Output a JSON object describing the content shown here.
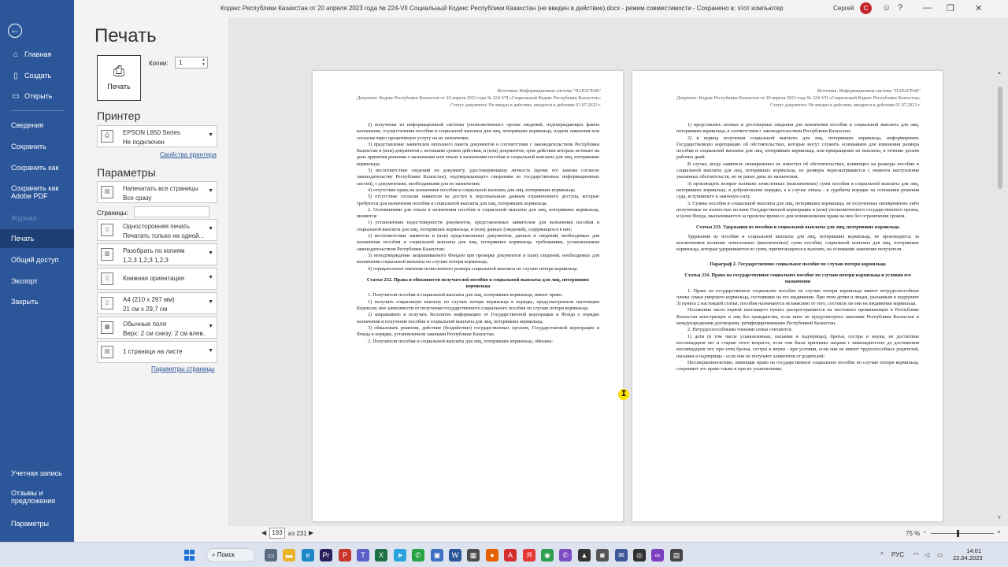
{
  "window": {
    "title": "Кодекс Республики Казахстан от 20 апреля 2023 года № 224-VII Социальный Кодекс Республики Казахстан (не введен в действие).docx  -  режим совместимости  -  Сохранено в: этот компьютер",
    "user": "Сергей",
    "avatar_initial": "С"
  },
  "nav": {
    "items": [
      {
        "label": "Главная",
        "icon": "home-icon"
      },
      {
        "label": "Создать",
        "icon": "new-document-icon"
      },
      {
        "label": "Открыть",
        "icon": "folder-icon"
      },
      {
        "label": "Сведения"
      },
      {
        "label": "Сохранить"
      },
      {
        "label": "Сохранить как"
      },
      {
        "label": "Сохранить как Adobe PDF"
      },
      {
        "label": "Журнал"
      },
      {
        "label": "Печать"
      },
      {
        "label": "Общий доступ"
      },
      {
        "label": "Экспорт"
      },
      {
        "label": "Закрыть"
      },
      {
        "label": "Учетная запись"
      },
      {
        "label": "Отзывы и предложения"
      },
      {
        "label": "Параметры"
      }
    ],
    "active": "Печать",
    "disabled": "Журнал"
  },
  "print": {
    "heading": "Печать",
    "button_label": "Печать",
    "copies_label": "Копии:",
    "copies_value": "1",
    "printer_heading": "Принтер",
    "printer_name": "EPSON L850 Series",
    "printer_status": "Не подключен",
    "printer_props_link": "Свойства принтера",
    "params_heading": "Параметры",
    "settings": [
      {
        "l1": "Напечатать все страницы",
        "l2": "Все сразу"
      },
      {
        "l1": "Односторонняя печать",
        "l2": "Печатать только на одной..."
      },
      {
        "l1": "Разобрать по копиям",
        "l2": "1,2,3    1,2,3    1,2,3"
      },
      {
        "l1": "Книжная ориентация",
        "l2": ""
      },
      {
        "l1": "A4 (210 x 297 мм)",
        "l2": "21 см x 29,7 см"
      },
      {
        "l1": "Обычные поля",
        "l2": "Верх: 2 см снизу: 2 см влев..."
      },
      {
        "l1": "1 страница на листе",
        "l2": ""
      }
    ],
    "pages_label": "Страницы:",
    "pages_value": "",
    "page_setup_link": "Параметры страницы"
  },
  "doc_header": {
    "source": "Источник: Информационная система \"ПАРАГРАФ\"",
    "document": "Документ: Кодекс Республики Казахстан от 20 апреля 2023 года № 224-VII «Социальный Кодекс Республики Казахстан»",
    "status": "Статус документа: Не введен в действие, вводится в действие 01.07.2023 г."
  },
  "page1": {
    "blocks": [
      {
        "t": "p",
        "text": "2) получение из информационной системы уполномоченного органа сведений, подтверждающих факты назначения, осуществления пособия и социальной выплаты для лиц, потерявших кормильца, подачи заявления или согласия через проактивную услугу на их назначение;"
      },
      {
        "t": "p",
        "text": "3) представление заявителем неполного пакета документов в соответствии с законодательством Республики Казахстан и (или) документов с истекшим сроком действия, и (или) документов, срок действия которых истекает на день принятия решения о назначении или отказе в назначении пособия и социальной выплаты для лиц, потерявших кормильца;"
      },
      {
        "t": "p",
        "text": "3) несоответствие сведений по документу, удостоверяющему личность (кроме его замены согласно законодательству Республики Казахстан), подтверждающего сведениям из государственных информационных систем), с документами, необходимыми для их назначения;"
      },
      {
        "t": "p",
        "text": "4) отсутствие права на назначение пособия и социальной выплаты для лиц, потерявших кормильца;"
      },
      {
        "t": "p",
        "text": "5) отсутствие согласия заявителя на доступ к персональным данным ограниченного доступа, которые требуются для назначения пособия и социальной выплаты для лиц, потерявших кормильца."
      },
      {
        "t": "p",
        "text": "2. Основаниями для отказа в назначении пособия и социальной выплаты для лиц, потерявших кормильца, являются:"
      },
      {
        "t": "p",
        "text": "1) установление недостоверности документов, представленных заявителем для назначения пособия и социальной выплаты для лиц, потерявших кормильца, и (или) данных (сведений), содержащихся в них;"
      },
      {
        "t": "p",
        "text": "2) несоответствие заявителя и (или) представленных документов, данных и сведений, необходимых для назначения пособия и социальной выплаты для лиц, потерявших кормильца, требованиям, установленным законодательством Республики Казахстан;"
      },
      {
        "t": "p",
        "text": "3) неподтверждение запрашиваемого Фондом при проверке документов и (или) сведений, необходимых для назначения социальной выплаты по случаю потери кормильца;"
      },
      {
        "t": "p",
        "text": "4) отрицательное значение исчисленного размера социальной выплаты по случаю потери кормильца."
      },
      {
        "t": "art",
        "text": "Статья 232. Права и обязанности получателей пособия и социальной выплаты для лиц, потерявших кормильца"
      },
      {
        "t": "p",
        "text": "1. Получатели пособия и социальной выплаты для лиц, потерявших кормильца, имеют право:"
      },
      {
        "t": "p",
        "text": "1) получить социальную выплату по случаю потери кормильца в порядке, предусмотренном настоящим Кодексом, вне зависимости от получения государственного социального пособия по случаю потери кормильца;"
      },
      {
        "t": "p",
        "text": "2) запрашивать и получать бесплатно информацию от Государственной корпорации и Фонда о порядке назначения и получения пособия и социальной выплаты для лиц, потерявших кормильца;"
      },
      {
        "t": "p",
        "text": "3) обжаловать решения, действия (бездействие) государственных органов, Государственной корпорации и Фонда в порядке, установленном законами Республики Казахстан."
      },
      {
        "t": "p",
        "text": "2. Получатели пособия и социальной выплаты для лиц, потерявших кормильца, обязаны:"
      }
    ]
  },
  "page2": {
    "blocks": [
      {
        "t": "p",
        "text": "1) представлять полные и достоверные сведения для назначения пособия и социальной выплаты для лиц, потерявших кормильца, в соответствии с законодательством Республики Казахстан;"
      },
      {
        "t": "p",
        "text": "2) в период получения социальной выплаты для лиц, потерявших кормильца, информировать Государственную корпорацию об обстоятельствах, которые могут служить основанием для изменения размера пособия и социальной выплаты для лиц, потерявших кормильца, или прекращения их выплаты, в течение десяти рабочих дней."
      },
      {
        "t": "p",
        "text": "В случае, когда заявитель своевременно не известил об обстоятельствах, влияющих на размеры пособия и социальной выплаты для лиц, потерявших кормильца, их размеры пересматриваются с момента наступления указанных обстоятельств, но не ранее даты их назначения;"
      },
      {
        "t": "p",
        "text": "3) производить возврат излишне зачисленных (выплаченных) сумм пособия и социальной выплаты для лиц, потерявших кормильца, в добровольном порядке, а в случае отказа - в судебном порядке на основании решения суда, вступившего в законную силу."
      },
      {
        "t": "p",
        "text": "3. Суммы пособия и социальной выплаты для лиц, потерявших кормильца, не полученные своевременно либо полученные не полностью по вине Государственной корпорации и (или) уполномоченного государственного органа, и (или) Фонда, выплачиваются за прошлое время со дня возникновения права на них без ограничения сроком."
      },
      {
        "t": "art",
        "text": "Статья 233. Удержания из пособия и социальной выплаты для лиц, потерявших кормильца"
      },
      {
        "t": "p",
        "text": "Удержания из пособия и социальной выплаты для лиц, потерявших кормильца, не производятся, за исключением излишне зачисленных (выплаченных) сумм пособия, социальной выплаты для лиц, потерявших кормильца, которые удерживаются из сумм, причитающихся к выплате, на основании заявления получателя."
      },
      {
        "t": "par",
        "text": "Параграф 2. Государственное социальное пособие по случаю потери кормильца"
      },
      {
        "t": "art",
        "text": "Статья 234. Право на государственное социальное пособие по случаю потери кормильца и условия его назначения"
      },
      {
        "t": "p",
        "text": "1. Право на государственное социальное пособие по случаю потери кормильца имеют нетрудоспособные члены семьи умершего кормильца, состоявшие на его иждивении. При этом детям и лицам, указанным в подпункте 3) пункта 2 настоящей статьи, пособия назначаются независимо от того, состояли ли они на иждивении кормильца."
      },
      {
        "t": "p",
        "text": "Положения части первой настоящего пункта распространяются на постоянно проживающих в Республике Казахстан иностранцев и лиц без гражданства, если иное не предусмотрено законами Республики Казахстан и международными договорами, ратифицированными Республикой Казахстан."
      },
      {
        "t": "p",
        "text": "2. Нетрудоспособными членами семьи считаются:"
      },
      {
        "t": "p",
        "text": "1) дети (в том числе усыновленные, пасынки и падчерицы), братья, сестры и внуки, не достигшие восемнадцати лет и старше этого возраста, если они были признаны лицами с инвалидностью до достижения восемнадцати лет, при этом братья, сестры и внуки - при условии, если они не имеют трудоспособных родителей, пасынки и падчерицы - если они не получают алиментов от родителей;"
      },
      {
        "t": "p",
        "text": "Несовершеннолетние, имеющие право на государственное социальное пособие по случаю потери кормильца, сохраняют это право также и при их усыновлении;"
      }
    ]
  },
  "cursor_glyph": "I",
  "preview": {
    "prev_arrow": "◀",
    "next_arrow": "▶",
    "current_page": "193",
    "total_pages": "из 231",
    "zoom": "75 %"
  },
  "taskbar": {
    "search_label": "Поиск",
    "apps": [
      {
        "icon": "task-view-icon",
        "glyph": "▭",
        "color": "#5b6b80"
      },
      {
        "icon": "file-explorer-icon",
        "glyph": "▬",
        "color": "#e8b32b"
      },
      {
        "icon": "edge-icon",
        "glyph": "e",
        "color": "#1e88c7"
      },
      {
        "icon": "premiere-icon",
        "glyph": "Pr",
        "color": "#2a1e5c"
      },
      {
        "icon": "pdf-reader-icon",
        "glyph": "P",
        "color": "#c8362b"
      },
      {
        "icon": "teams-icon",
        "glyph": "T",
        "color": "#5b5fc7"
      },
      {
        "icon": "excel-icon",
        "glyph": "X",
        "color": "#1d7044"
      },
      {
        "icon": "telegram-icon",
        "glyph": "➤",
        "color": "#2aa3dd"
      },
      {
        "icon": "whatsapp-icon",
        "glyph": "✆",
        "color": "#25a244"
      },
      {
        "icon": "photos-icon",
        "glyph": "▣",
        "color": "#3c6fc4"
      },
      {
        "icon": "word-icon",
        "glyph": "W",
        "color": "#2b579a"
      },
      {
        "icon": "store-icon",
        "glyph": "▦",
        "color": "#4a4a4a"
      },
      {
        "icon": "firefox-icon",
        "glyph": "●",
        "color": "#e66000"
      },
      {
        "icon": "acrobat-icon",
        "glyph": "A",
        "color": "#d32f2f"
      },
      {
        "icon": "yandex-icon",
        "glyph": "Я",
        "color": "#e53935"
      },
      {
        "icon": "chrome-icon",
        "glyph": "◉",
        "color": "#2e9e4f"
      },
      {
        "icon": "viber-icon",
        "glyph": "✆",
        "color": "#7b4cc4"
      },
      {
        "icon": "app-icon",
        "glyph": "▲",
        "color": "#333333"
      },
      {
        "icon": "camera-icon",
        "glyph": "◙",
        "color": "#555555"
      },
      {
        "icon": "messenger-icon",
        "glyph": "✉",
        "color": "#3b5998"
      },
      {
        "icon": "obs-icon",
        "glyph": "◎",
        "color": "#303030"
      },
      {
        "icon": "infinity-icon",
        "glyph": "∞",
        "color": "#7e3fbf"
      },
      {
        "icon": "calculator-icon",
        "glyph": "▤",
        "color": "#444444"
      }
    ],
    "lang": "РУС",
    "time": "14:01",
    "date": "22.04.2023"
  }
}
